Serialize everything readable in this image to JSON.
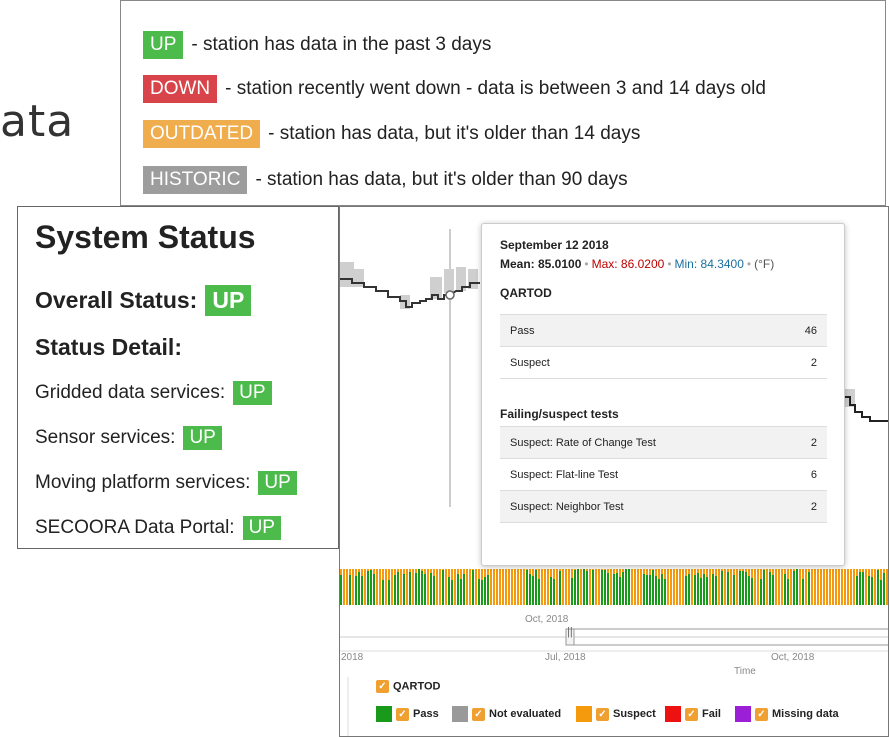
{
  "background_fragment": "ata",
  "legend": {
    "up": {
      "tag": "UP",
      "text": "- station has data in the past 3 days"
    },
    "down": {
      "tag": "DOWN",
      "text": "- station recently went down - data is between 3 and 14 days old"
    },
    "outdated": {
      "tag": "OUTDATED",
      "text": "- station has data, but it's older than 14 days"
    },
    "historic": {
      "tag": "HISTORIC",
      "text": "- station has data, but it's older than 90 days"
    }
  },
  "system_status": {
    "title": "System Status",
    "overall_label": "Overall Status:",
    "overall_value": "UP",
    "detail_label": "Status Detail:",
    "services": [
      {
        "label": "Gridded data services:",
        "value": "UP"
      },
      {
        "label": "Sensor services:",
        "value": "UP"
      },
      {
        "label": "Moving platform services:",
        "value": "UP"
      },
      {
        "label": "SECOORA Data Portal:",
        "value": "UP"
      }
    ]
  },
  "tooltip": {
    "date": "September 12 2018",
    "mean": "Mean: 85.0100",
    "max": "Max: 86.0200",
    "min": "Min: 84.3400",
    "unit": "(°F)",
    "qartod_title": "QARTOD",
    "qartod_rows": [
      {
        "label": "Pass",
        "value": "46"
      },
      {
        "label": "Suspect",
        "value": "2"
      }
    ],
    "failing_title": "Failing/suspect tests",
    "failing_rows": [
      {
        "label": "Suspect: Rate of Change Test",
        "value": "2"
      },
      {
        "label": "Suspect: Flat-line Test",
        "value": "6"
      },
      {
        "label": "Suspect: Neighbor Test",
        "value": "2"
      }
    ]
  },
  "chart_labels": {
    "oct_top": "Oct, 2018",
    "nav_left": "2018",
    "nav_mid": "Jul, 2018",
    "nav_right": "Oct, 2018",
    "time_label": "Time",
    "handle": "||"
  },
  "chart_legend": {
    "title": "QARTOD",
    "items": [
      {
        "label": "Pass",
        "color": "#1a9a1a"
      },
      {
        "label": "Not evaluated",
        "color": "#999999"
      },
      {
        "label": "Suspect",
        "color": "#f59a0c"
      },
      {
        "label": "Fail",
        "color": "#ee1111"
      },
      {
        "label": "Missing data",
        "color": "#9b1fd6"
      }
    ]
  },
  "colors": {
    "up": "#4cbb4c",
    "down": "#d9444a",
    "outdated": "#f0ad4e",
    "historic": "#9d9d9d"
  }
}
